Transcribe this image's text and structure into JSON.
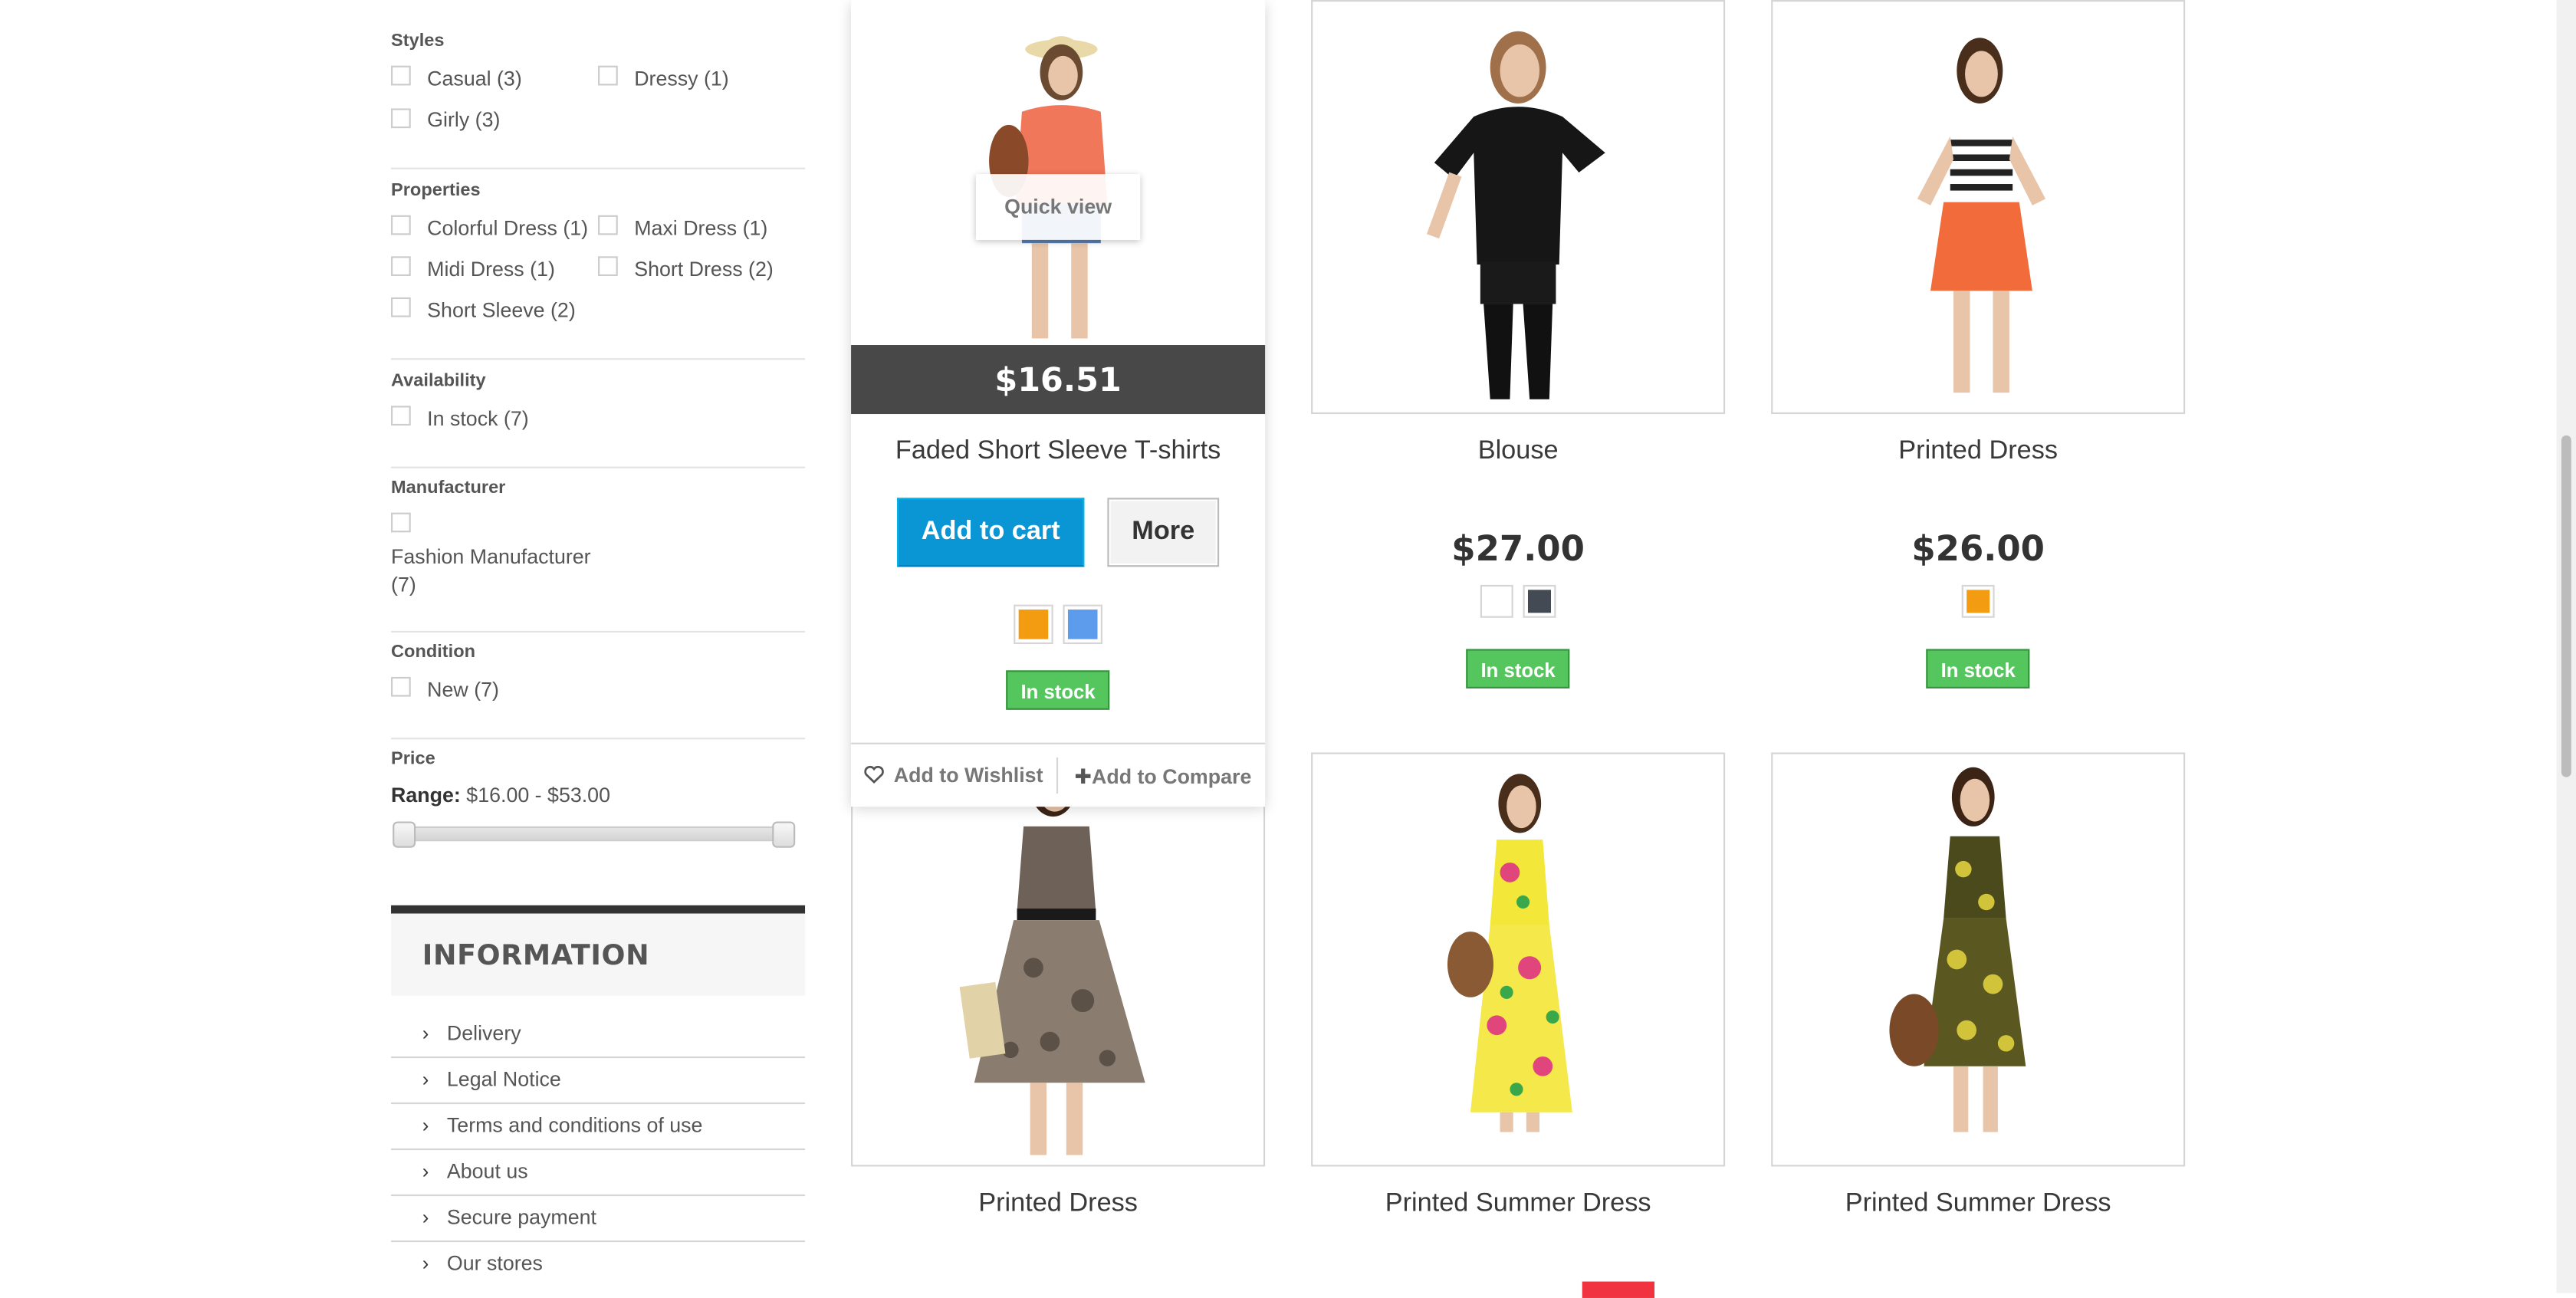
{
  "filters": {
    "styles": {
      "title": "Styles",
      "options": [
        "Casual (3)",
        "Dressy (1)",
        "Girly (3)"
      ]
    },
    "properties": {
      "title": "Properties",
      "options": [
        "Colorful Dress (1)",
        "Maxi Dress (1)",
        "Midi Dress (1)",
        "Short Dress (2)",
        "Short Sleeve (2)"
      ]
    },
    "availability": {
      "title": "Availability",
      "options": [
        "In stock (7)"
      ]
    },
    "manufacturer": {
      "title": "Manufacturer",
      "options": [
        "Fashion Manufacturer (7)"
      ]
    },
    "condition": {
      "title": "Condition",
      "options": [
        "New (7)"
      ]
    },
    "price": {
      "title": "Price",
      "range_label": "Range:",
      "range_value": "$16.00 - $53.00",
      "min": 16,
      "max": 53
    }
  },
  "information": {
    "title": "INFORMATION",
    "links": [
      "Delivery",
      "Legal Notice",
      "Terms and conditions of use",
      "About us",
      "Secure payment",
      "Our stores"
    ]
  },
  "products": [
    {
      "name": "Faded Short Sleeve T-shirts",
      "price": "$16.51",
      "colors": [
        "#f39c11",
        "#5d9cec"
      ],
      "stock": "In stock",
      "hovered": true
    },
    {
      "name": "Blouse",
      "price": "$27.00",
      "colors": [
        "#ffffff",
        "#434a54"
      ],
      "stock": "In stock"
    },
    {
      "name": "Printed Dress",
      "price": "$26.00",
      "colors": [
        "#f39c11"
      ],
      "stock": "In stock"
    },
    {
      "name": "Printed Dress"
    },
    {
      "name": "Printed Summer Dress"
    },
    {
      "name": "Printed Summer Dress"
    }
  ],
  "hover": {
    "quick_view": "Quick view",
    "add_to_cart": "Add to cart",
    "more": "More",
    "wishlist": "Add to Wishlist",
    "compare": "Add to Compare"
  }
}
